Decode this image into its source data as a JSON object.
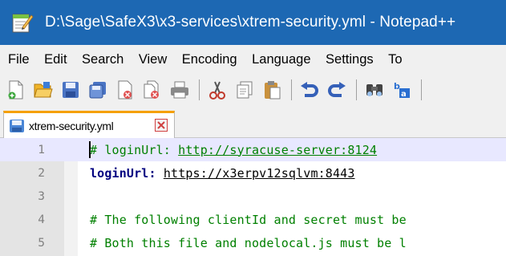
{
  "window": {
    "title": "D:\\Sage\\SafeX3\\x3-services\\xtrem-security.yml - Notepad++",
    "icon": "notepadpp-icon",
    "colors": {
      "titlebar": "#1d68b3",
      "title_text": "#ffffff"
    }
  },
  "menu": {
    "items": [
      "File",
      "Edit",
      "Search",
      "View",
      "Encoding",
      "Language",
      "Settings",
      "To"
    ]
  },
  "toolbar": {
    "buttons": [
      "new-file-icon",
      "open-file-icon",
      "save-icon",
      "save-all-icon",
      "close-icon",
      "close-all-icon",
      "print-icon",
      "cut-icon",
      "copy-icon",
      "paste-icon",
      "undo-icon",
      "redo-icon",
      "find-icon",
      "replace-icon"
    ]
  },
  "tab": {
    "label": "xtrem-security.yml",
    "accent": "#f5a000"
  },
  "editor": {
    "lines": [
      {
        "number": "1",
        "prefix": "# loginUrl: ",
        "link": "http://syracuse-server:8124"
      },
      {
        "number": "2",
        "key": "loginUrl:",
        "sep": " ",
        "value": "https://x3erpv12sqlvm:8443"
      },
      {
        "number": "3",
        "text": ""
      },
      {
        "number": "4",
        "text": "# The following clientId and secret must be"
      },
      {
        "number": "5",
        "text": "# Both this file and nodelocal.js must be l"
      }
    ],
    "colors": {
      "comment": "#008000",
      "key": "#000080",
      "current_line": "#e8e8ff"
    }
  }
}
